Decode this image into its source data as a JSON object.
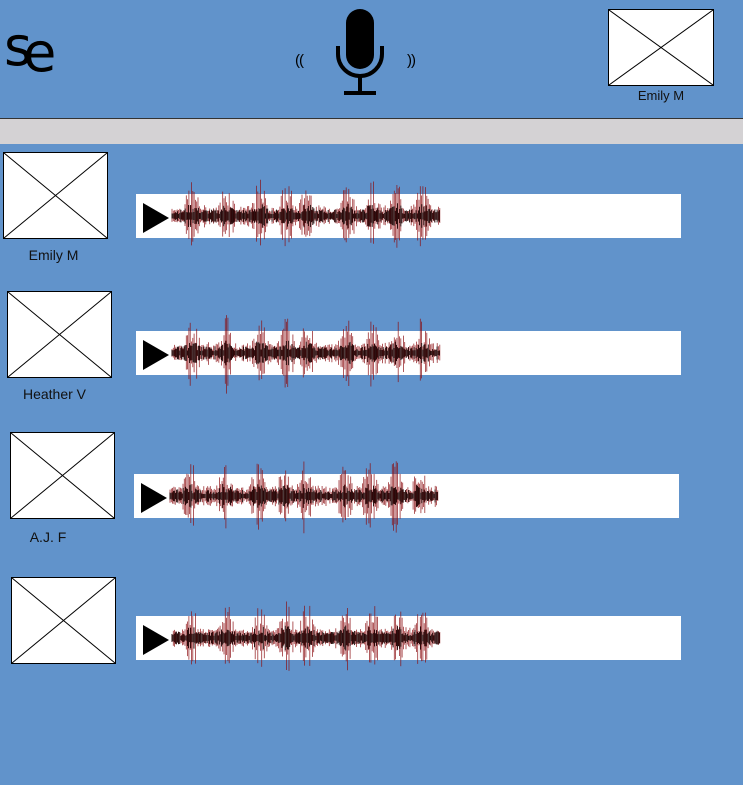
{
  "app": {
    "logo_s": "s",
    "logo_e": "e"
  },
  "header": {
    "wave_left": "((",
    "wave_right": "))",
    "current_user": "Emily M",
    "mic_icon": "microphone-icon"
  },
  "messages": [
    {
      "sender": "Emily M"
    },
    {
      "sender": "Heather V"
    },
    {
      "sender": "A.J. F"
    },
    {
      "sender": ""
    }
  ],
  "colors": {
    "background": "#6193cb",
    "toolbar": "#d4d2d4",
    "waveform": "#8b0d10",
    "waveform_core": "#1a0000"
  }
}
